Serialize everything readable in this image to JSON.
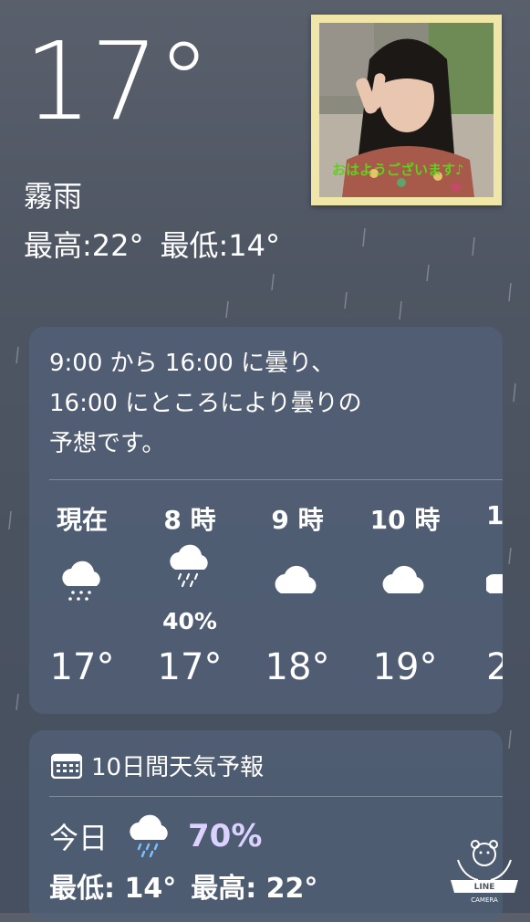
{
  "current": {
    "temperature": "17°",
    "condition": "霧雨",
    "high": "最高:22°",
    "low": "最低:14°"
  },
  "photo": {
    "caption": "おはようございます♪"
  },
  "hourly_card": {
    "summary_line1": "9:00 から 16:00 に曇り、",
    "summary_line2": "16:00 にところにより曇りの",
    "summary_line3": "予想です。",
    "hours": [
      {
        "label": "現在",
        "icon": "drizzle-icon",
        "pop": "",
        "temp": "17°"
      },
      {
        "label": "8 時",
        "icon": "rain-icon",
        "pop": "40%",
        "temp": "17°"
      },
      {
        "label": "9 時",
        "icon": "cloud-icon",
        "pop": "",
        "temp": "18°"
      },
      {
        "label": "10 時",
        "icon": "cloud-icon",
        "pop": "",
        "temp": "19°"
      },
      {
        "label": "1",
        "icon": "cloud-icon",
        "pop": "",
        "temp": "2"
      }
    ]
  },
  "forecast_card": {
    "title": "10日間天気予報",
    "today_label": "今日",
    "today_pop": "70%",
    "today_low": "最低: 14°",
    "today_high": "最高: 22°"
  },
  "badge": {
    "line1": "LINE",
    "line2": "CAMERA"
  }
}
